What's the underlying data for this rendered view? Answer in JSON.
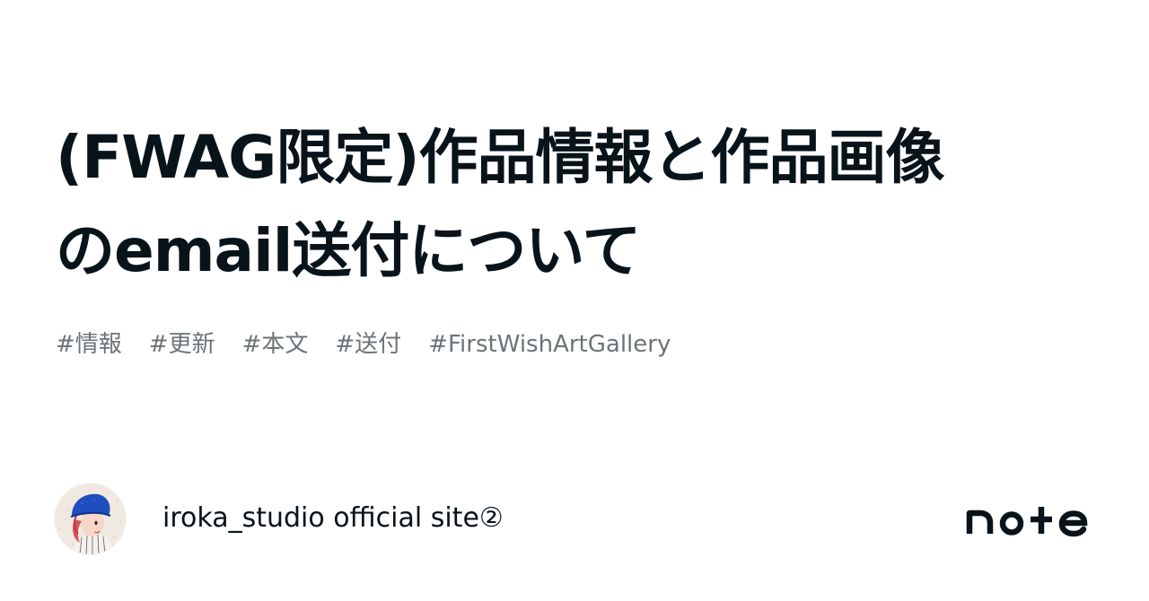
{
  "title": {
    "line1": "(FWAG限定)作品情報と作品画像",
    "line2": "のemail送付について"
  },
  "hashtags": [
    "#情報",
    "#更新",
    "#本文",
    "#送付",
    "#FirstWishArtGallery"
  ],
  "author": {
    "name": "iroka_studio official site②",
    "avatar_icon": "avatar-illustration"
  },
  "brand": {
    "name": "note",
    "icon": "note-logo"
  },
  "colors": {
    "background": "#ffffff",
    "title_text": "#08131a",
    "hashtag_text": "#6b7378",
    "avatar_hat": "#1f4fbf",
    "avatar_hair": "#d9535c"
  }
}
